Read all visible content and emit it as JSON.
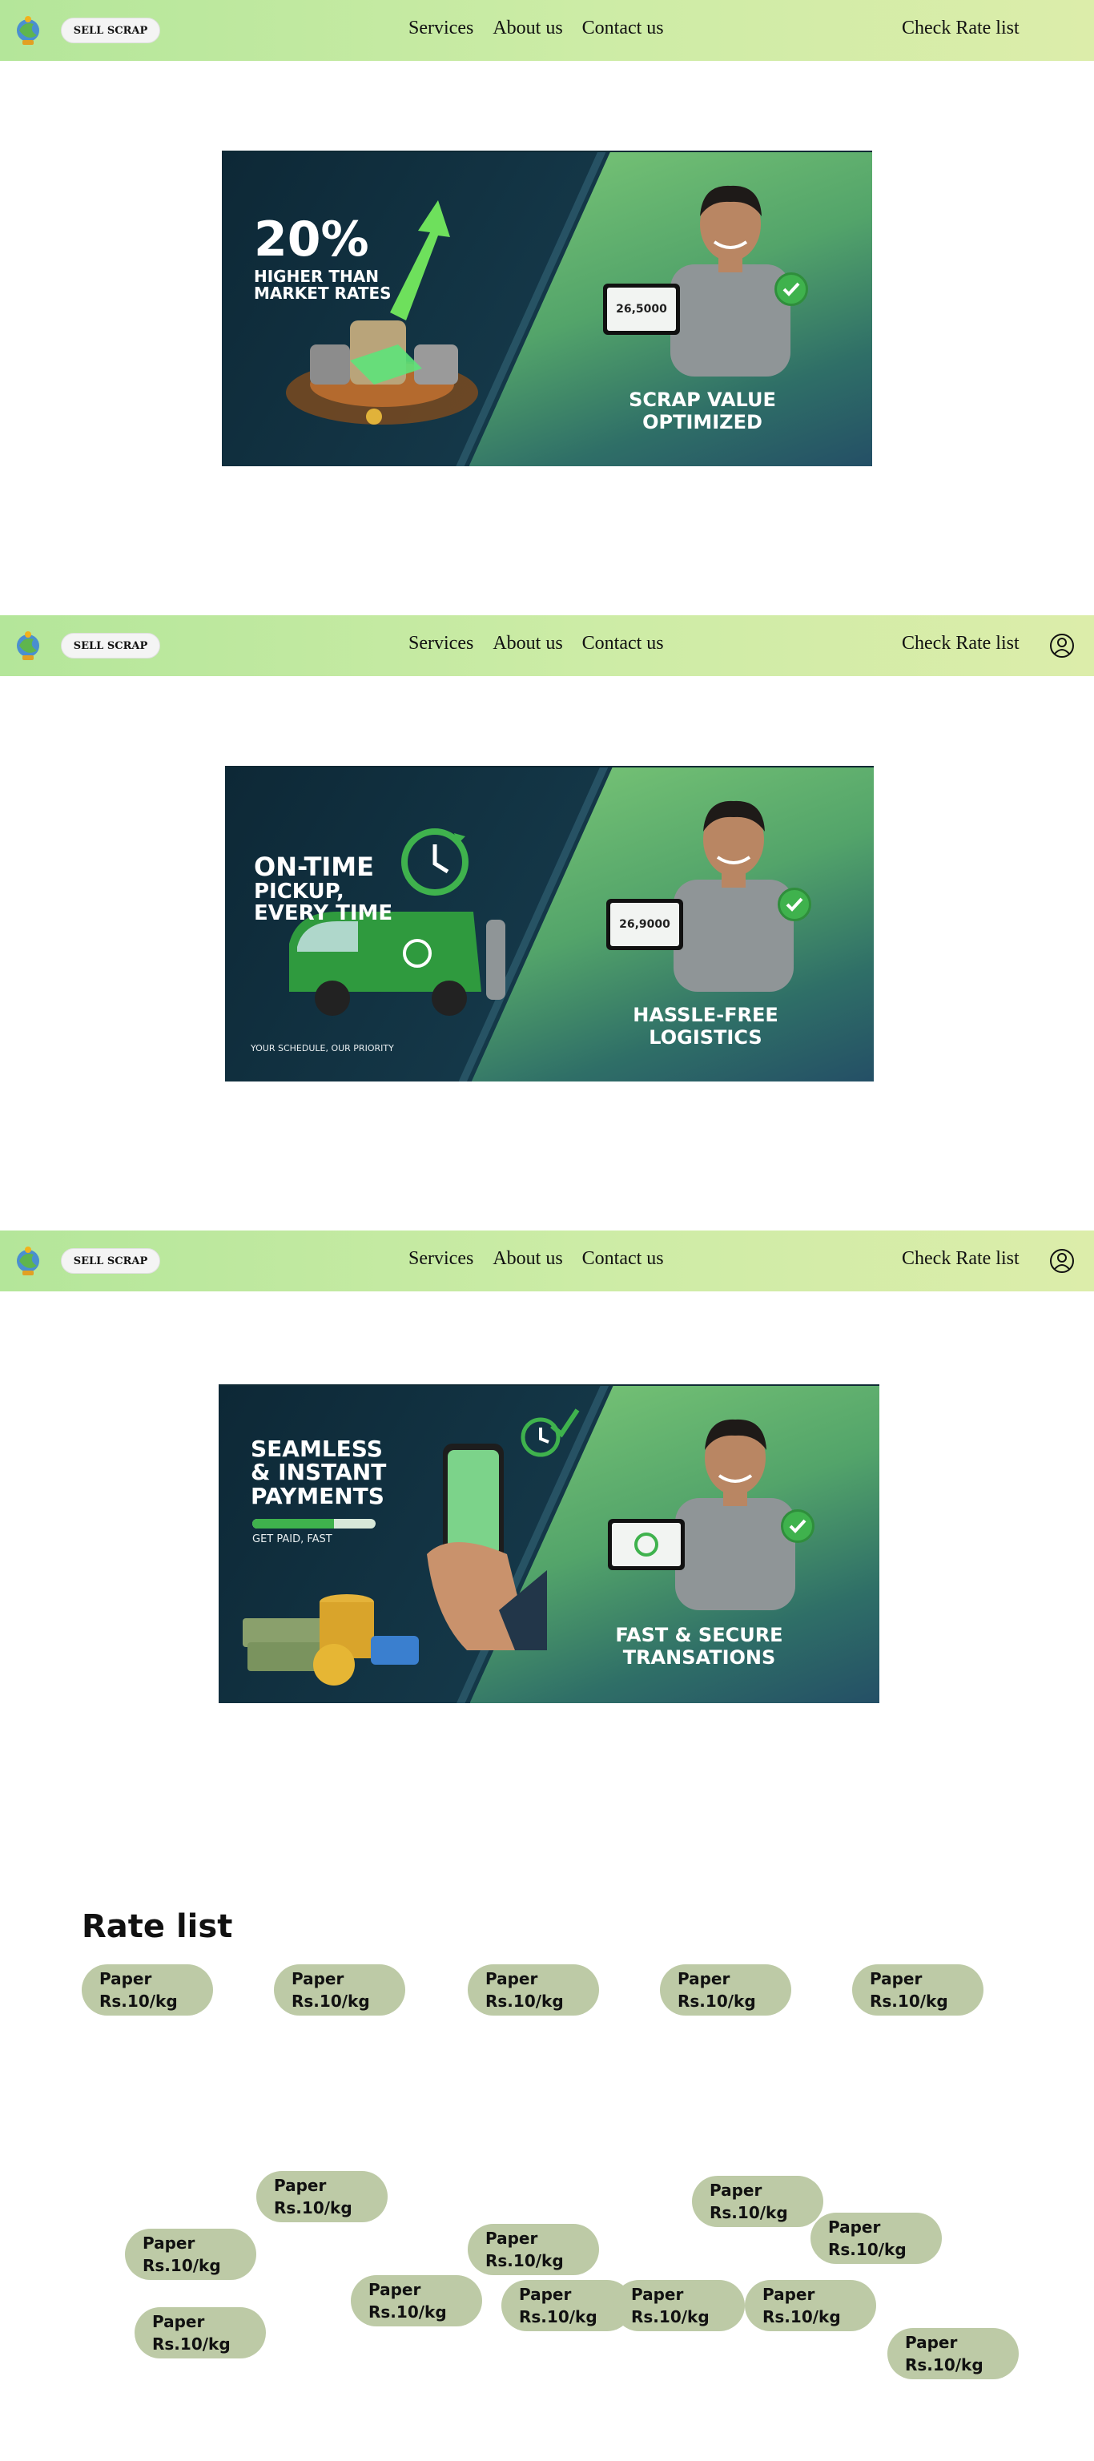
{
  "nav": {
    "sell_label": "SELL SCRAP",
    "links": [
      "Services",
      "About us",
      "Contact us"
    ],
    "check_rate": "Check Rate list"
  },
  "banners": [
    {
      "headline_big": "20%",
      "headline_lines": [
        "HIGHER THAN",
        "MARKET RATES"
      ],
      "tablet_value": "26,5000",
      "caption_lines": [
        "SCRAP VALUE",
        "OPTIMIZED"
      ]
    },
    {
      "headline_lines": [
        "ON-TIME",
        "PICKUP,",
        "EVERY TIME"
      ],
      "subtext": "YOUR SCHEDULE, OUR PRIORITY",
      "tablet_value": "26,9000",
      "caption_lines": [
        "HASSLE-FREE",
        "LOGISTICS"
      ]
    },
    {
      "headline_lines": [
        "SEAMLESS",
        "& INSTANT",
        "PAYMENTS"
      ],
      "subtext": "GET PAID, FAST",
      "caption_lines": [
        "FAST & SECURE",
        "TRANSATIONS"
      ]
    }
  ],
  "rate_list": {
    "title": "Rate list",
    "item_name": "Paper",
    "item_price": "Rs.10/kg"
  }
}
